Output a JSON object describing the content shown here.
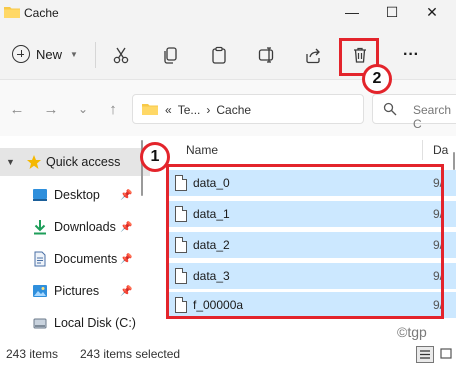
{
  "window": {
    "title": "Cache",
    "minimize_glyph": "—",
    "maximize_glyph": "☐",
    "close_glyph": "✕"
  },
  "command_bar": {
    "new_label": "New",
    "more_glyph": "···",
    "tools": [
      "cut-icon",
      "copy-icon",
      "paste-icon",
      "rename-icon",
      "share-icon",
      "delete-icon",
      "more-options-icon"
    ]
  },
  "navigation": {
    "back_glyph": "←",
    "forward_glyph": "→",
    "recent_glyph": "⌄",
    "up_glyph": "↑"
  },
  "address_bar": {
    "overflow": "«",
    "segments": [
      "Te...",
      "Cache"
    ],
    "separator": "›"
  },
  "search": {
    "placeholder": "Search C"
  },
  "nav_pane": {
    "items": [
      {
        "label": "Quick access",
        "icon": "star-icon"
      },
      {
        "label": "Desktop",
        "icon": "desktop-icon"
      },
      {
        "label": "Downloads",
        "icon": "download-icon"
      },
      {
        "label": "Documents",
        "icon": "documents-icon"
      },
      {
        "label": "Pictures",
        "icon": "pictures-icon"
      },
      {
        "label": "Local Disk (C:)",
        "icon": "drive-icon"
      }
    ]
  },
  "file_list": {
    "columns": {
      "name": "Name",
      "date": "Da"
    },
    "files": [
      {
        "name": "data_0",
        "date": "9/"
      },
      {
        "name": "data_1",
        "date": "9/"
      },
      {
        "name": "data_2",
        "date": "9/"
      },
      {
        "name": "data_3",
        "date": "9/"
      },
      {
        "name": "f_00000a",
        "date": "9/"
      }
    ]
  },
  "status_bar": {
    "item_count": "243 items",
    "selected_count": "243 items selected"
  },
  "annotations": {
    "callout_1": "1",
    "callout_2": "2",
    "watermark": "©tgp"
  },
  "colors": {
    "selection": "#cce8ff",
    "annotation_red": "#e3242b",
    "folder_yellow": "#f7c948"
  }
}
